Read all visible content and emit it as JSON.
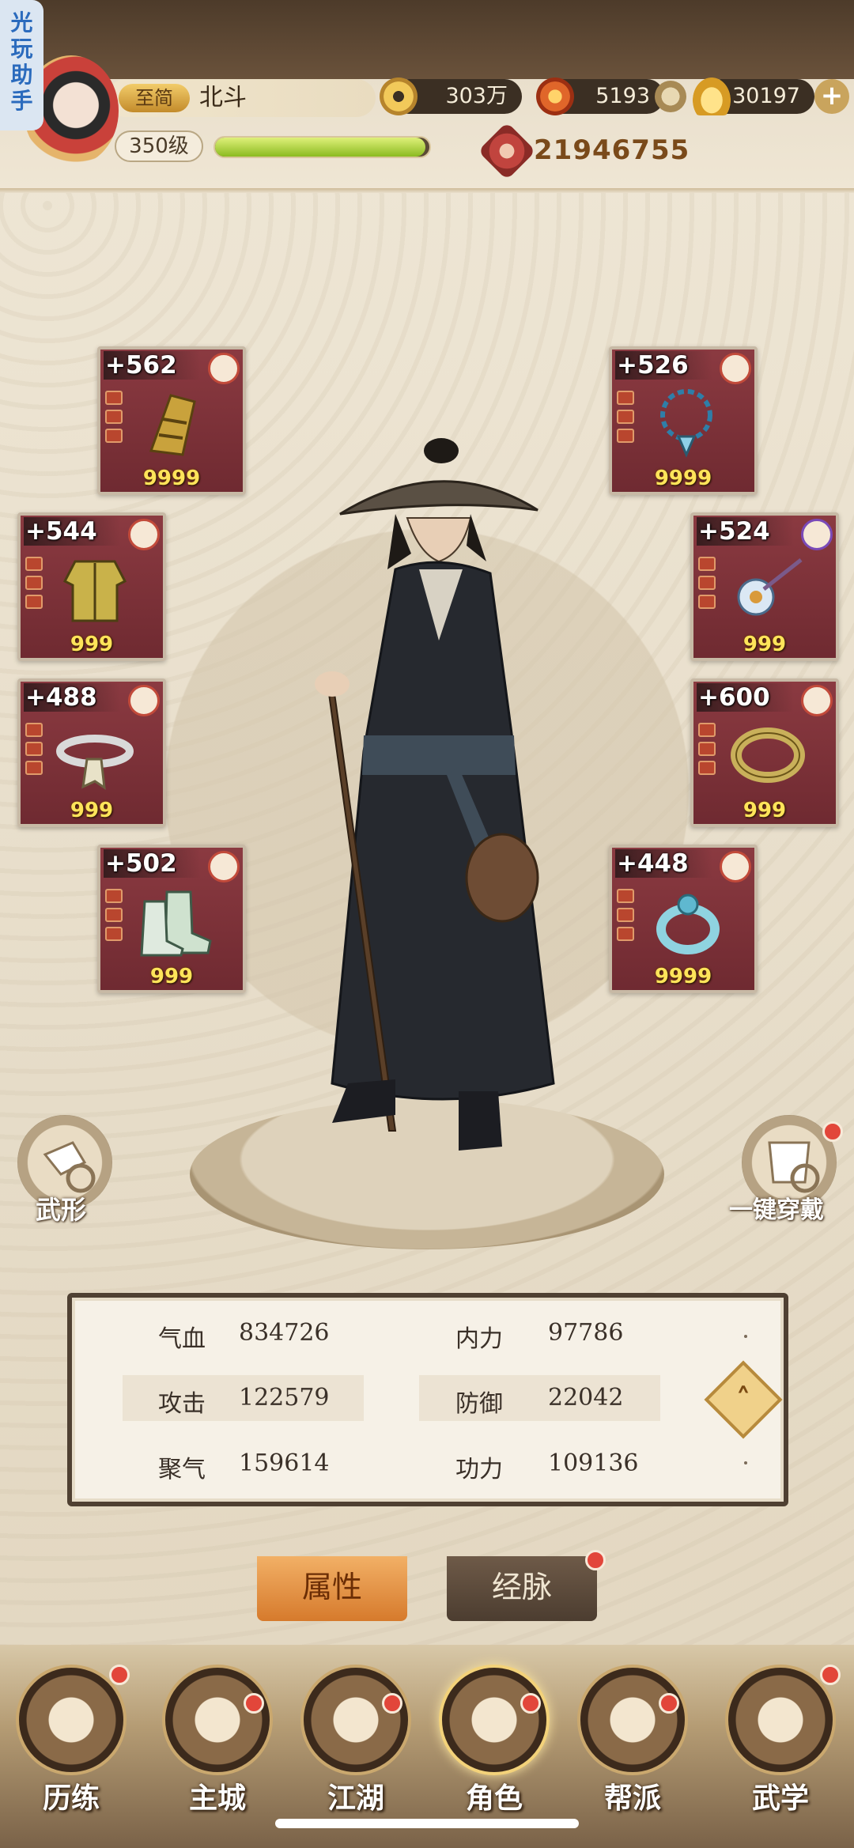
{
  "helper": {
    "label": "光玩助手"
  },
  "player": {
    "vip_tag": "至简",
    "name": "北斗",
    "level": "350级",
    "exp_progress": 0.98,
    "combat_power": "21946755"
  },
  "resources": {
    "coins": "303万",
    "flame": "5193",
    "gold": "30197"
  },
  "equipment": {
    "left": [
      {
        "level": "+562",
        "count": "9999",
        "item": "bracer-icon"
      },
      {
        "level": "+544",
        "count": "999",
        "item": "armor-icon"
      },
      {
        "level": "+488",
        "count": "999",
        "item": "belt-icon"
      },
      {
        "level": "+502",
        "count": "999",
        "item": "boots-icon"
      }
    ],
    "right": [
      {
        "level": "+526",
        "count": "9999",
        "item": "necklace-icon"
      },
      {
        "level": "+524",
        "count": "999",
        "item": "hairpin-icon"
      },
      {
        "level": "+600",
        "count": "999",
        "item": "bracelet-icon"
      },
      {
        "level": "+448",
        "count": "9999",
        "item": "ring-icon"
      }
    ]
  },
  "side_buttons": {
    "appearance": "武形",
    "equip_all": "一键穿戴"
  },
  "stats": [
    {
      "label": "气血",
      "value": "834726"
    },
    {
      "label": "内力",
      "value": "97786"
    },
    {
      "label": "攻击",
      "value": "122579"
    },
    {
      "label": "防御",
      "value": "22042"
    },
    {
      "label": "聚气",
      "value": "159614"
    },
    {
      "label": "功力",
      "value": "109136"
    }
  ],
  "tabs": {
    "attributes": "属性",
    "meridians": "经脉"
  },
  "nav": [
    {
      "label": "历练"
    },
    {
      "label": "主城"
    },
    {
      "label": "江湖"
    },
    {
      "label": "角色"
    },
    {
      "label": "帮派"
    },
    {
      "label": "武学"
    }
  ],
  "colors": {
    "accent_red": "#e2463a",
    "panel_border": "#4f4032",
    "slot_bg": "#7a2f36",
    "tab_active": "#d67a2c"
  }
}
